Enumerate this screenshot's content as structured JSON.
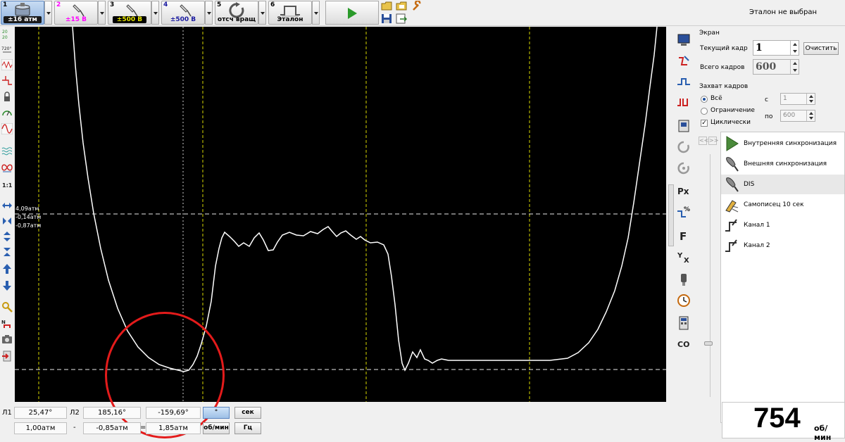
{
  "toolbar": {
    "channels": [
      {
        "num": "1",
        "label": "±16 атм",
        "color": "#1a1a1a",
        "active": true
      },
      {
        "num": "2",
        "label": "±15 В",
        "color": "#ff00ff",
        "active": false
      },
      {
        "num": "3",
        "label": "±500 В",
        "color": "#e6e600",
        "active": false
      },
      {
        "num": "4",
        "label": "±500 В",
        "color": "#1a1aa0",
        "active": false
      },
      {
        "num": "5",
        "label": "отсч вращ",
        "color": "#000000",
        "active": false
      },
      {
        "num": "6",
        "label": "Эталон",
        "color": "#000000",
        "active": false
      }
    ],
    "status": "Эталон не выбран"
  },
  "scope": {
    "cursor_labels": [
      "4,09атм",
      "-0,14атм",
      "-0,87атм"
    ],
    "trace_color": "#ffffff",
    "grid_color": "#d8d800"
  },
  "bottom": {
    "l1_label": "Л1",
    "l1_angle": "25,47°",
    "l1_pressure": "1,00атм",
    "l2_label": "Л2",
    "l2_angle": "185,16°",
    "l2_pressure": "-0,85атм",
    "minus_sign": "-",
    "equals_sign": "=",
    "delta_angle": "-159,69°",
    "delta_pressure": "1,85атм",
    "unit_deg": "°",
    "unit_sec": "сек",
    "unit_rpm": "об/мин",
    "unit_hz": "Гц"
  },
  "right_icons": [
    "screen-icon",
    "sync-icon",
    "trigger-icon",
    "trigger2-icon",
    "memory-icon",
    "rotate-icon",
    "rotate2-icon",
    "px-icon",
    "percent-icon",
    "f-icon",
    "yx-icon",
    "probe-icon",
    "clock-icon",
    "calc-icon",
    "co-icon"
  ],
  "panel": {
    "screen_title": "Экран",
    "current_frame_label": "Текущий кадр",
    "current_frame": "1",
    "clear_label": "Очистить",
    "total_frames_label": "Всего кадров",
    "total_frames": "600",
    "capture_title": "Захват кадров",
    "all_label": "Всё",
    "limit_label": "Ограничение",
    "cyclic_label": "Циклически",
    "from_label": "с",
    "from_value": "1",
    "to_label": "по",
    "to_value": "600",
    "nav_prev": "<<",
    "nav_next": ">>",
    "sync_items": [
      {
        "label": "Внутренняя синхронизация",
        "icon": "play-triangle-icon",
        "selected": false
      },
      {
        "label": "Внешняя синхронизация",
        "icon": "probe-icon",
        "selected": false
      },
      {
        "label": "DIS",
        "icon": "probe-icon",
        "selected": true
      },
      {
        "label": "Самописец 10 сек",
        "icon": "pen-recorder-icon",
        "selected": false
      },
      {
        "label": "Канал 1",
        "icon": "channel-edge-icon",
        "selected": false
      },
      {
        "label": "Канал 2",
        "icon": "channel-edge-icon",
        "selected": false
      }
    ]
  },
  "rpm": {
    "value": "754",
    "unit": "об/мин"
  }
}
